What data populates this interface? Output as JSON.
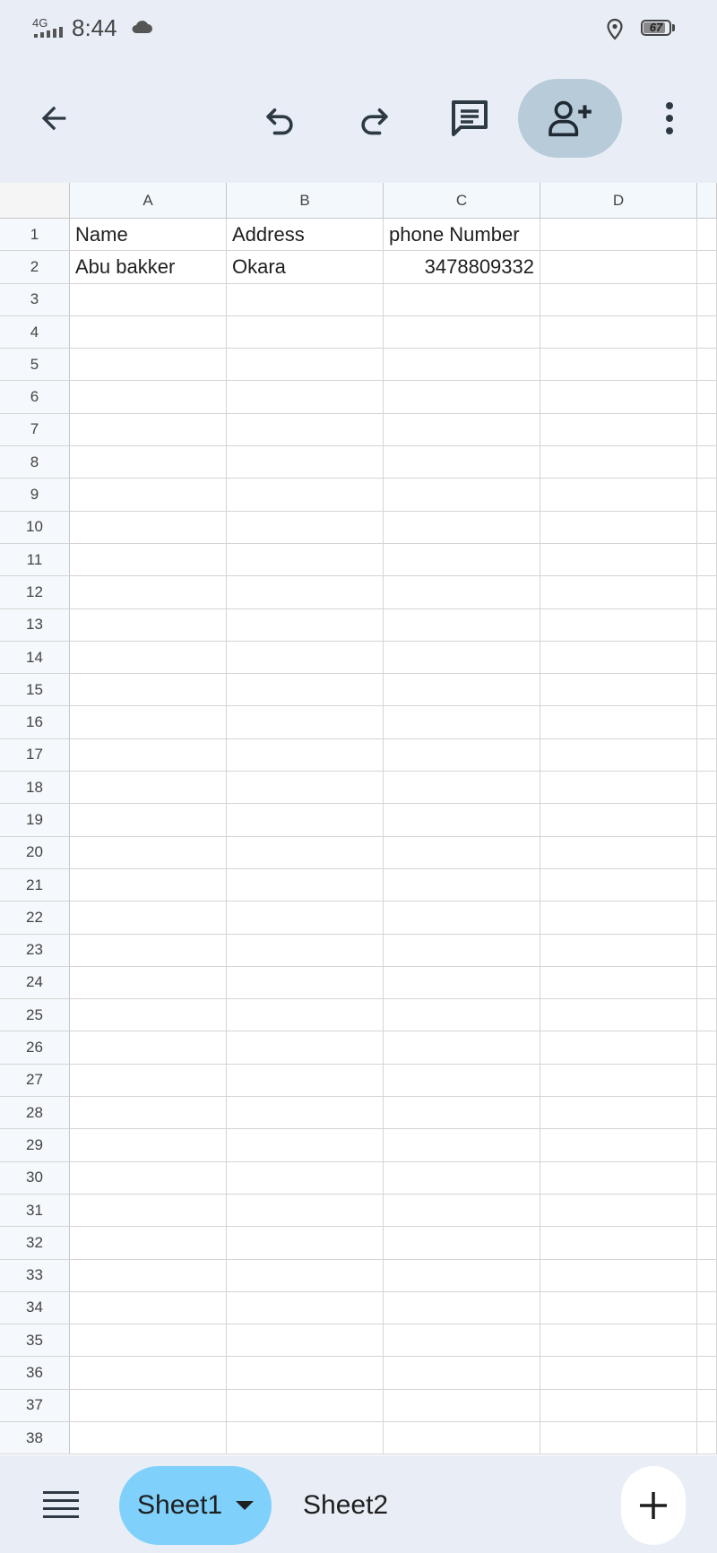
{
  "status_bar": {
    "network": "4G",
    "time": "8:44",
    "battery": "67"
  },
  "toolbar": {
    "icons": [
      "back-arrow-icon",
      "undo-icon",
      "redo-icon",
      "comment-icon",
      "add-person-icon",
      "more-vert-icon"
    ]
  },
  "sheet": {
    "columns": [
      "A",
      "B",
      "C",
      "D"
    ],
    "rows": [
      {
        "n": "1",
        "a": "Name",
        "b": "Address",
        "c": "phone Number",
        "d": ""
      },
      {
        "n": "2",
        "a": "Abu bakker",
        "b": "Okara",
        "c": "3478809332",
        "d": ""
      },
      {
        "n": "3"
      },
      {
        "n": "4"
      },
      {
        "n": "5"
      },
      {
        "n": "6"
      },
      {
        "n": "7"
      },
      {
        "n": "8"
      },
      {
        "n": "9"
      },
      {
        "n": "10"
      },
      {
        "n": "11"
      },
      {
        "n": "12"
      },
      {
        "n": "13"
      },
      {
        "n": "14"
      },
      {
        "n": "15"
      },
      {
        "n": "16"
      },
      {
        "n": "17"
      },
      {
        "n": "18"
      },
      {
        "n": "19"
      },
      {
        "n": "20"
      },
      {
        "n": "21"
      },
      {
        "n": "22"
      },
      {
        "n": "23"
      },
      {
        "n": "24"
      },
      {
        "n": "25"
      },
      {
        "n": "26"
      },
      {
        "n": "27"
      },
      {
        "n": "28"
      },
      {
        "n": "29"
      },
      {
        "n": "30"
      },
      {
        "n": "31"
      },
      {
        "n": "32"
      },
      {
        "n": "33"
      },
      {
        "n": "34"
      },
      {
        "n": "35"
      },
      {
        "n": "36"
      },
      {
        "n": "37"
      },
      {
        "n": "38"
      }
    ]
  },
  "bottom_bar": {
    "tabs": [
      {
        "label": "Sheet1",
        "active": true
      },
      {
        "label": "Sheet2",
        "active": false
      }
    ]
  },
  "colors": {
    "background": "#e9eef6",
    "active_tab": "#7fd1fc",
    "share_button": "#b7cbd9"
  }
}
